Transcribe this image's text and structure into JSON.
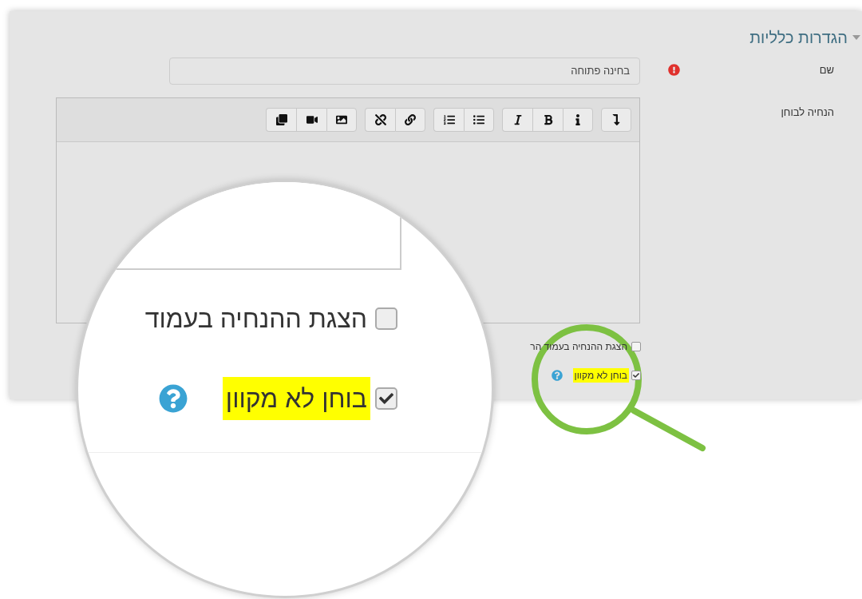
{
  "section": {
    "title": "הגדרות כלליות",
    "expanded": true
  },
  "name_field": {
    "label": "שם",
    "required": true,
    "value": "בחינה פתוחה"
  },
  "editor": {
    "label": "הנחיה לבוחן"
  },
  "options": [
    {
      "label": "הצגת ההנחיה בעמוד הר",
      "checked": false,
      "highlighted": false,
      "help": false
    },
    {
      "label": "בוחן לא מקוון",
      "checked": true,
      "highlighted": true,
      "help": true
    }
  ],
  "magnifier": {
    "options": [
      {
        "label": "הצגת ההנחיה בעמוד",
        "checked": false,
        "highlighted": false,
        "help": false
      },
      {
        "label": "בוחן לא מקוון",
        "checked": true,
        "highlighted": true,
        "help": true
      }
    ]
  }
}
